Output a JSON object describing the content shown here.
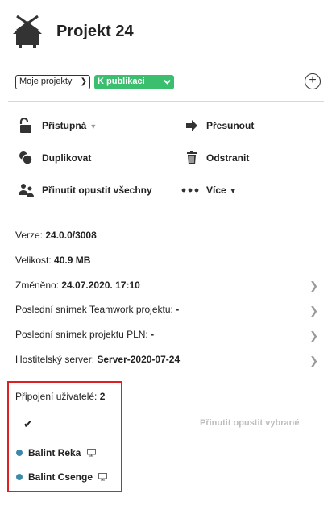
{
  "header": {
    "title": "Projekt 24",
    "icon": "hut-icon"
  },
  "filters": {
    "project_filter": "Moje projekty",
    "status_badge": "K publikaci",
    "add_icon": "plus-circle-icon"
  },
  "actions": {
    "access": "Přístupná",
    "move": "Přesunout",
    "duplicate": "Duplikovat",
    "delete": "Odstranit",
    "force_leave_all": "Přinutit opustit všechny",
    "more": "Více"
  },
  "info": {
    "version_label": "Verze:",
    "version_value": "24.0.0/3008",
    "size_label": "Velikost:",
    "size_value": "40.9 MB",
    "modified_label": "Změněno:",
    "modified_value": "24.07.2020. 17:10",
    "teamwork_label": "Poslední snímek Teamwork projektu:",
    "teamwork_value": "-",
    "pln_label": "Poslední snímek projektu PLN:",
    "pln_value": "-",
    "host_label": "Hostitelský server:",
    "host_value": "Server-2020-07-24"
  },
  "connections": {
    "label": "Připojení uživatelé:",
    "count": "2",
    "force_selected": "Přinutit opustit vybrané",
    "users": [
      {
        "name": "Balint Reka"
      },
      {
        "name": "Balint Csenge"
      }
    ]
  },
  "colors": {
    "accent_green": "#3bbf6e",
    "user_dot": "#3d8aa8",
    "highlight_border": "#e02020"
  }
}
